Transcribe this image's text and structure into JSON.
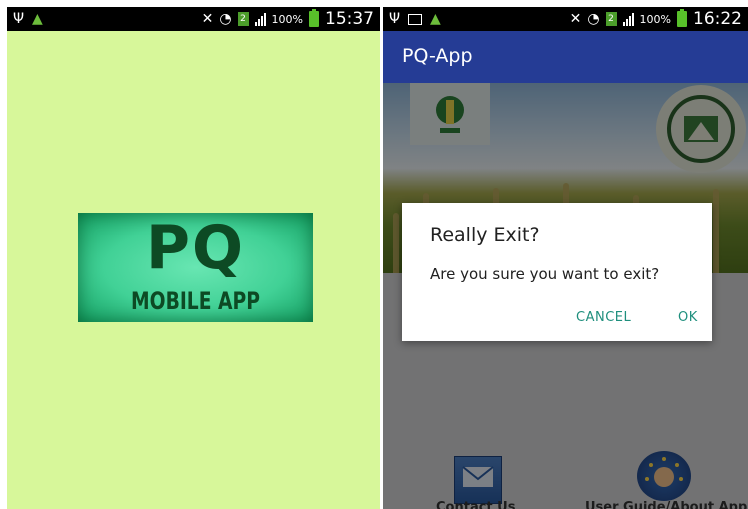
{
  "left_screen": {
    "status": {
      "battery_pct": "100%",
      "time": "15:37",
      "sim_badge": "2"
    },
    "splash": {
      "logo_big": "PQ",
      "logo_small": "MOBILE APP",
      "background_color": "#d7f79a"
    }
  },
  "right_screen": {
    "status": {
      "battery_pct": "100%",
      "time": "16:22",
      "sim_badge": "2"
    },
    "appbar": {
      "title": "PQ-App",
      "color": "#253c95"
    },
    "dialog": {
      "title": "Really Exit?",
      "message": "Are you sure you want to exit?",
      "cancel_label": "CANCEL",
      "ok_label": "OK",
      "button_color": "#1f8f7d"
    },
    "bottom_nav": [
      {
        "label": "Contact Us",
        "icon": "contact-us-icon"
      },
      {
        "label": "User Guide/About App",
        "icon": "user-guide-icon"
      }
    ]
  }
}
